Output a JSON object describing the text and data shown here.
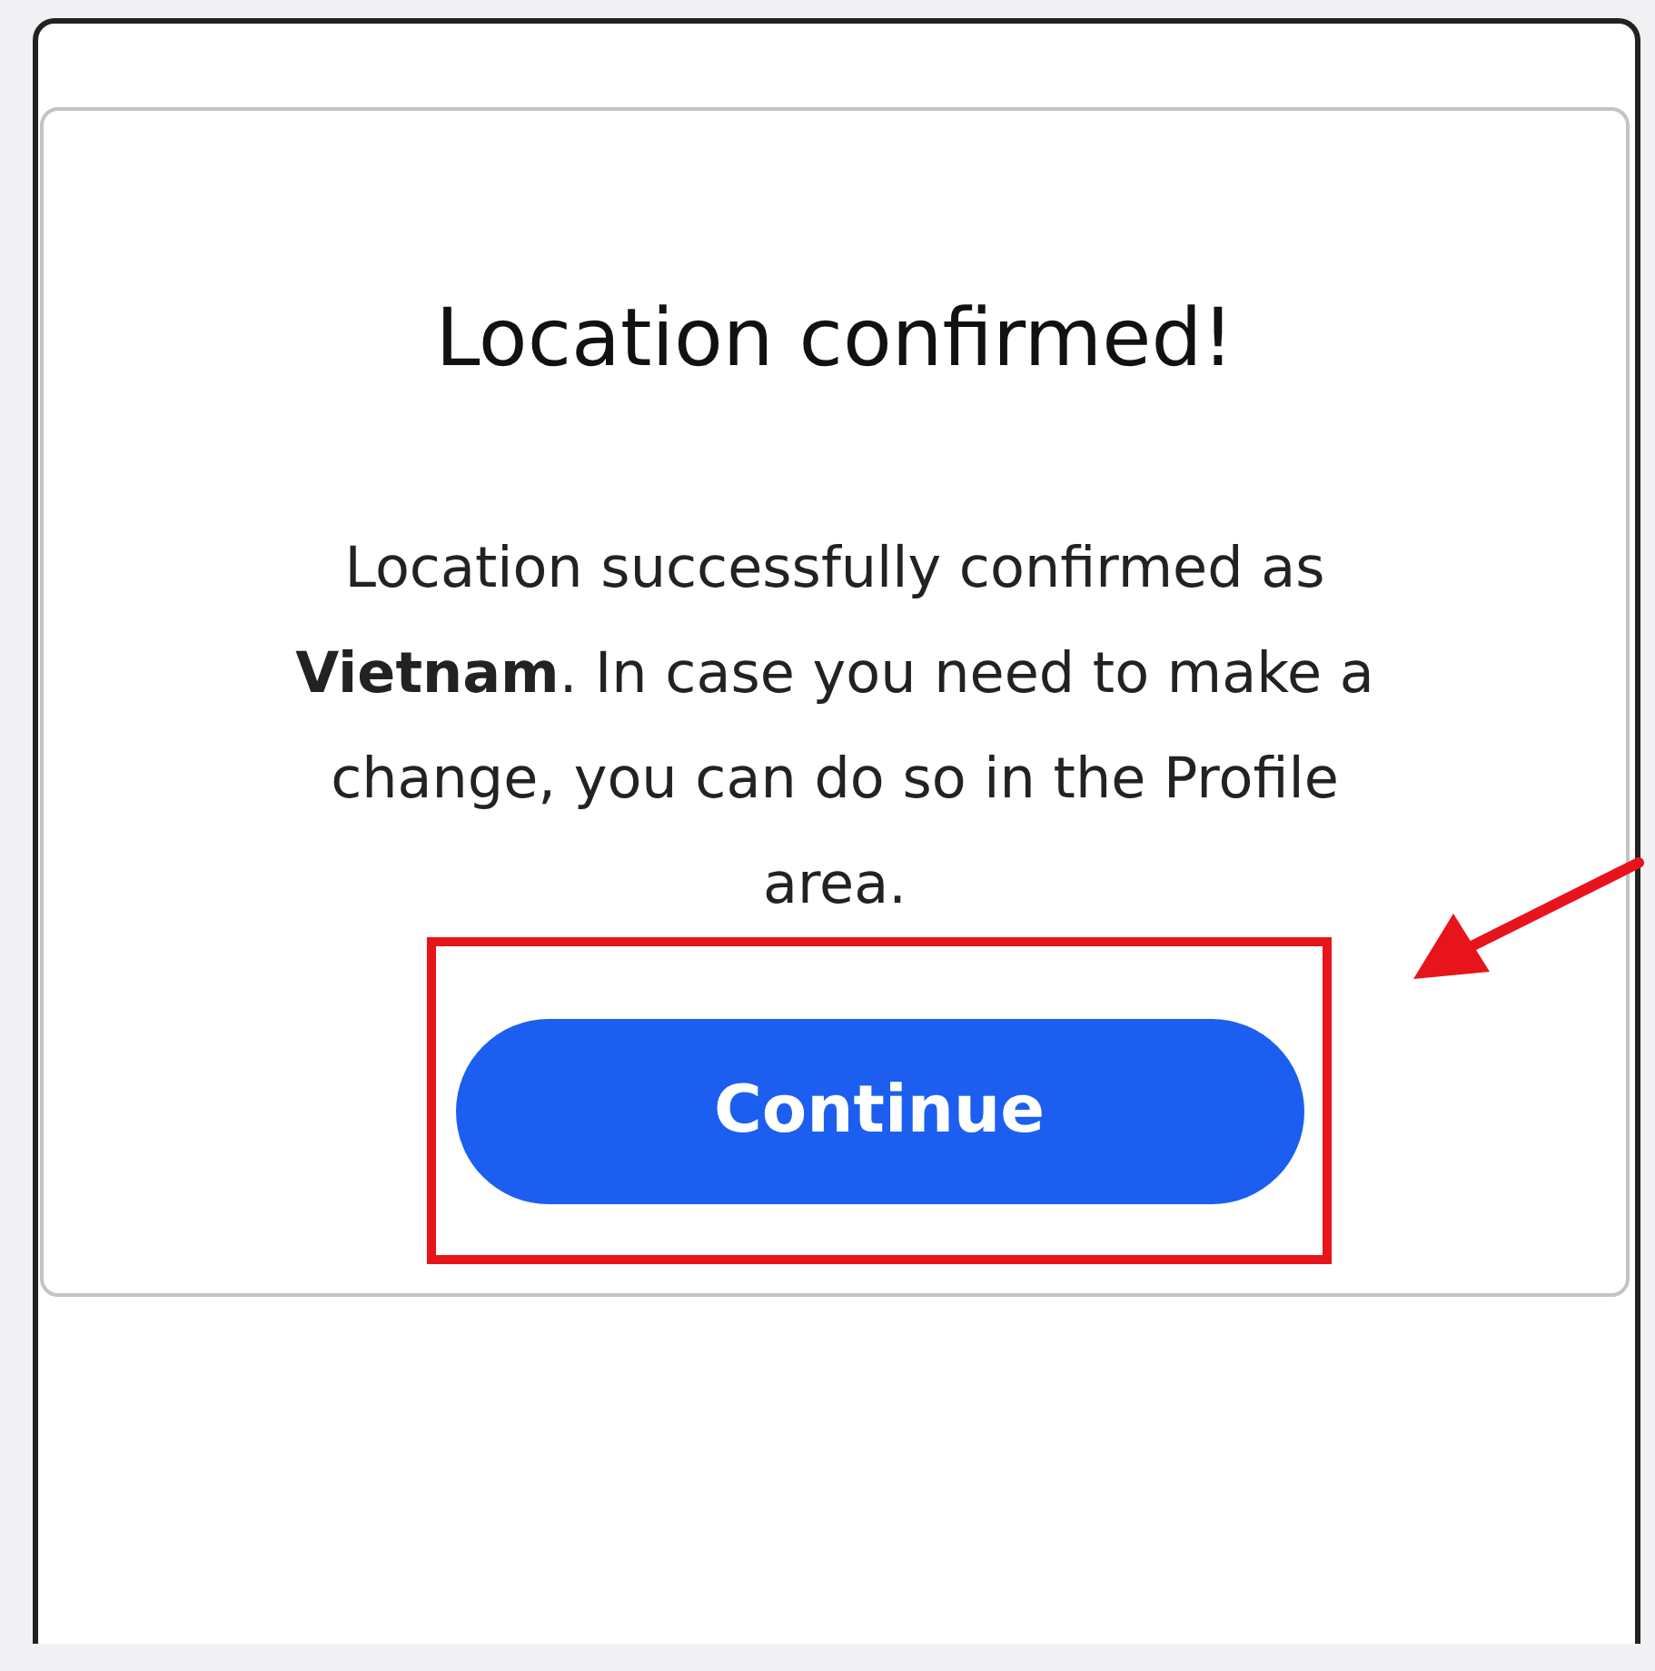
{
  "dialog": {
    "title": "Location confirmed!",
    "message": "Location successfully confirmed as **Vietnam**. In case you need to make a change, you can do so in the Profile area.",
    "button": "Continue"
  },
  "annotations": {
    "highlight_box": true,
    "arrow": true
  }
}
